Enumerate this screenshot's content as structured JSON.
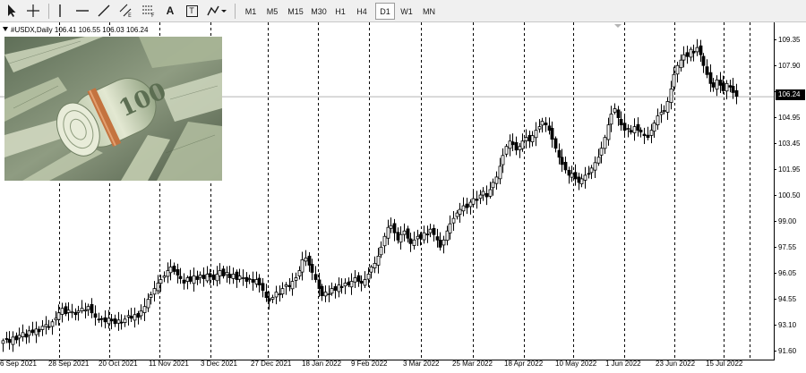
{
  "toolbar": {
    "tools": [
      {
        "icon": "cursor-arrow-icon"
      },
      {
        "icon": "crosshair-icon"
      },
      {
        "icon": "vertical-line-icon"
      },
      {
        "icon": "horizontal-line-icon"
      },
      {
        "icon": "trendline-icon"
      },
      {
        "icon": "equidistant-channel-icon"
      },
      {
        "icon": "fibonacci-retracement-icon"
      },
      {
        "icon": "text-icon",
        "label": "A"
      },
      {
        "icon": "text-label-icon",
        "label": "T"
      },
      {
        "icon": "shapes-menu-icon"
      }
    ],
    "timeframes": [
      "M1",
      "M5",
      "M15",
      "M30",
      "H1",
      "H4",
      "D1",
      "W1",
      "MN"
    ],
    "active_timeframe": "D1"
  },
  "chart": {
    "symbol_header": "#USDX,Daily  106.41 106.55 106.03 106.24",
    "current_price_label": "106.24",
    "image_alt": "Rolled US dollar banknotes"
  },
  "chart_data": {
    "type": "candlestick",
    "symbol": "#USDX",
    "timeframe": "Daily",
    "last_bar": {
      "open": 106.41,
      "high": 106.55,
      "low": 106.03,
      "close": 106.24
    },
    "current_price": 106.24,
    "ylim": [
      91.6,
      110.2
    ],
    "y_ticks": [
      "109.35",
      "107.90",
      "106.24",
      "104.95",
      "103.45",
      "101.95",
      "100.50",
      "99.00",
      "97.55",
      "96.05",
      "94.55",
      "93.10",
      "91.60"
    ],
    "x_ticks": [
      "6 Sep 2021",
      "28 Sep 2021",
      "20 Oct 2021",
      "11 Nov 2021",
      "3 Dec 2021",
      "27 Dec 2021",
      "18 Jan 2022",
      "9 Feb 2022",
      "3 Mar 2022",
      "25 Mar 2022",
      "18 Apr 2022",
      "10 May 2022",
      "1 Jun 2022",
      "23 Jun 2022",
      "15 Jul 2022"
    ],
    "grid": {
      "vertical_dashed": true,
      "horizontal": false
    },
    "bullish_candle_color": "#ffffff",
    "bearish_candle_color": "#000000",
    "closes": [
      92.65,
      92.75,
      92.55,
      92.85,
      92.7,
      92.95,
      93.1,
      92.85,
      93.2,
      93.1,
      93.3,
      93.15,
      93.45,
      93.55,
      93.4,
      93.7,
      93.9,
      94.2,
      94.45,
      94.15,
      94.35,
      94.25,
      94.1,
      94.3,
      94.45,
      94.35,
      94.55,
      94.2,
      93.95,
      93.8,
      93.85,
      93.7,
      93.9,
      93.75,
      93.6,
      93.8,
      93.65,
      93.85,
      94.05,
      93.9,
      94.1,
      93.95,
      94.3,
      94.55,
      94.95,
      95.2,
      95.55,
      95.85,
      96.05,
      96.25,
      96.55,
      96.75,
      96.5,
      96.3,
      96.1,
      95.85,
      96.15,
      95.95,
      96.25,
      96.05,
      96.3,
      96.1,
      96.35,
      96.2,
      96.05,
      96.35,
      96.55,
      96.25,
      96.45,
      96.15,
      96.35,
      96.05,
      96.25,
      96.15,
      95.95,
      96.1,
      95.9,
      96.05,
      95.75,
      95.45,
      95.05,
      94.85,
      95.05,
      95.35,
      95.25,
      95.55,
      95.75,
      95.65,
      95.95,
      96.15,
      96.55,
      97.15,
      97.25,
      96.85,
      96.45,
      96.05,
      95.55,
      95.15,
      95.35,
      95.25,
      95.55,
      95.45,
      95.75,
      95.6,
      95.85,
      95.75,
      95.95,
      96.15,
      95.95,
      95.85,
      96.05,
      96.35,
      96.75,
      96.95,
      97.35,
      97.85,
      98.45,
      98.95,
      99.05,
      98.65,
      98.25,
      98.55,
      98.75,
      98.35,
      98.05,
      98.25,
      98.45,
      98.35,
      98.65,
      98.55,
      98.85,
      98.55,
      98.25,
      97.85,
      98.25,
      98.75,
      99.15,
      99.45,
      99.75,
      99.95,
      100.15,
      100.05,
      100.35,
      100.55,
      100.45,
      100.75,
      100.95,
      100.65,
      101.05,
      101.45,
      101.75,
      102.35,
      102.95,
      103.45,
      103.75,
      103.55,
      103.25,
      103.45,
      103.75,
      103.95,
      103.75,
      104.05,
      104.35,
      104.55,
      104.85,
      104.65,
      104.35,
      103.85,
      103.35,
      102.85,
      102.45,
      102.15,
      101.85,
      101.95,
      101.65,
      101.45,
      101.65,
      101.85,
      101.95,
      102.25,
      102.55,
      102.85,
      103.35,
      103.95,
      104.65,
      105.25,
      105.55,
      105.05,
      104.65,
      104.35,
      104.45,
      104.25,
      104.55,
      104.35,
      104.25,
      104.05,
      103.95,
      104.35,
      104.75,
      105.15,
      105.35,
      105.45,
      105.95,
      106.65,
      107.45,
      107.95,
      108.25,
      108.55,
      108.45,
      108.85,
      108.65,
      108.95,
      108.55,
      107.95,
      107.45,
      106.95,
      106.75,
      107.15,
      106.85,
      106.55,
      106.95,
      106.75,
      106.45,
      106.24
    ]
  }
}
